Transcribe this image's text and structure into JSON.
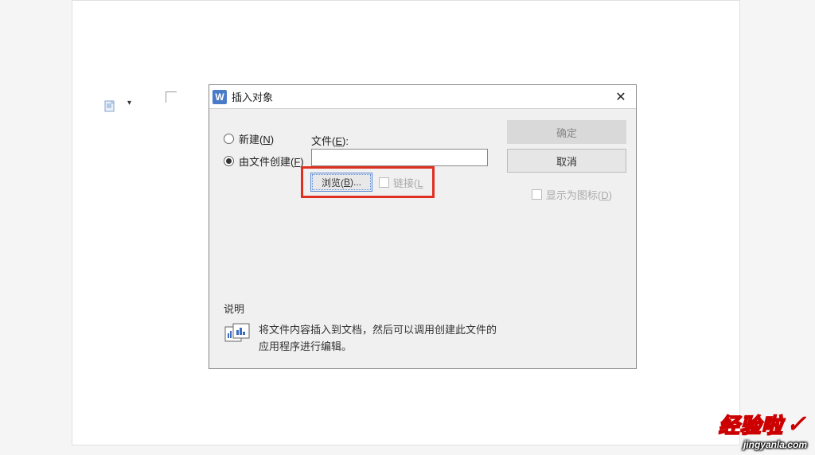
{
  "dialog": {
    "title": "插入对象",
    "app_icon": "W",
    "options": {
      "new_label": "新建(<u>N</u>)",
      "from_file_label": "由文件创建(<u>F</u>)"
    },
    "file_label": "文件(<u>E</u>):",
    "browse_label": "浏览(<u>B</u>)...",
    "link_label": "链接(<u>L</u>",
    "ok_label": "确定",
    "cancel_label": "取消",
    "show_as_icon_label": "显示为图标(<u>D</u>)",
    "description": {
      "heading": "说明",
      "text": "将文件内容插入到文档，然后可以调用创建此文件的应用程序进行编辑。"
    }
  },
  "watermark": {
    "main": "经验啦",
    "sub": "jingyanla.com"
  }
}
